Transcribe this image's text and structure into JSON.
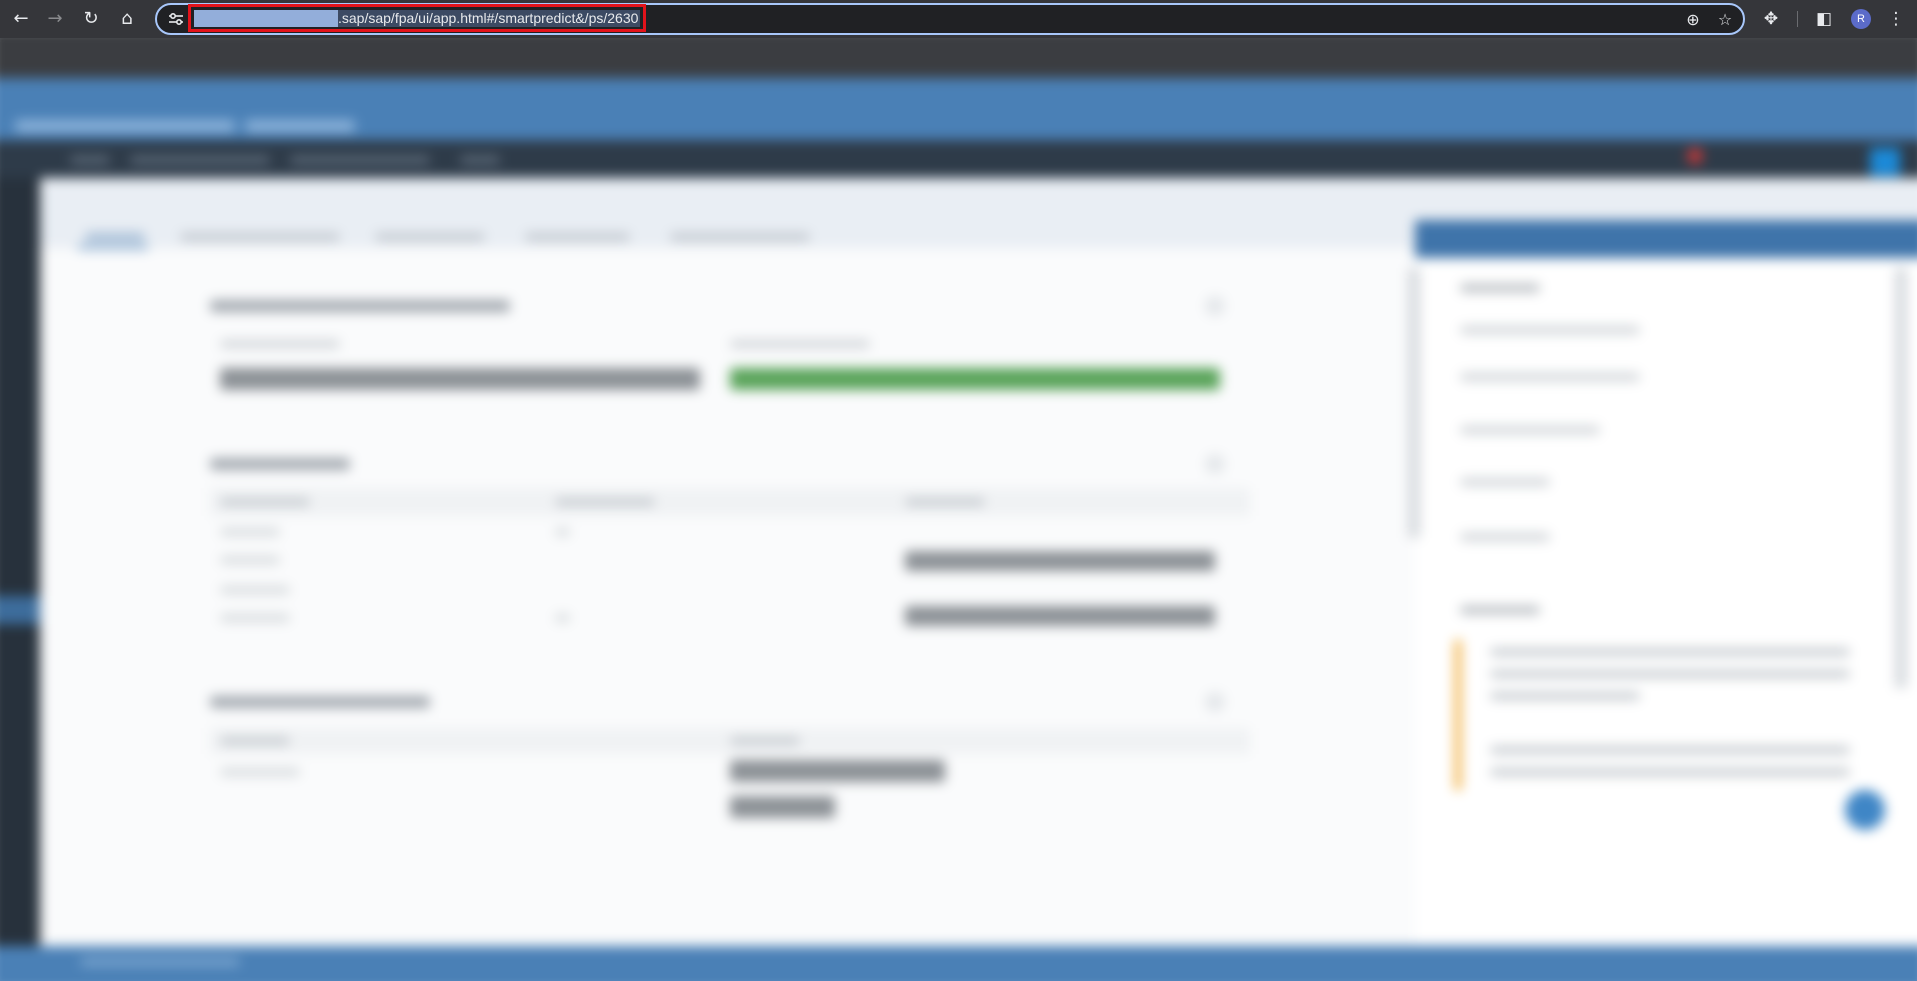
{
  "browser": {
    "url_redacted": "",
    "url": ".sap/sap/fpa/ui/app.html#/smartpredict&/ps/2630",
    "profile_initial": "R",
    "icons": {
      "back": "back-arrow-icon",
      "forward": "forward-arrow-icon",
      "reload": "reload-icon",
      "home": "home-icon",
      "site_info": "tune-icon",
      "zoom": "zoom-icon",
      "bookmark": "star-icon",
      "extensions": "puzzle-icon",
      "side_panel": "side-panel-icon",
      "menu": "kebab-menu-icon"
    },
    "highlight_color": "#e3131b"
  },
  "colors": {
    "shell": "#4a7fb5",
    "shell_dark": "#2d3a48",
    "success": "#5aa45a",
    "neutral_bar": "#8c9196",
    "warning": "#f0a830"
  }
}
